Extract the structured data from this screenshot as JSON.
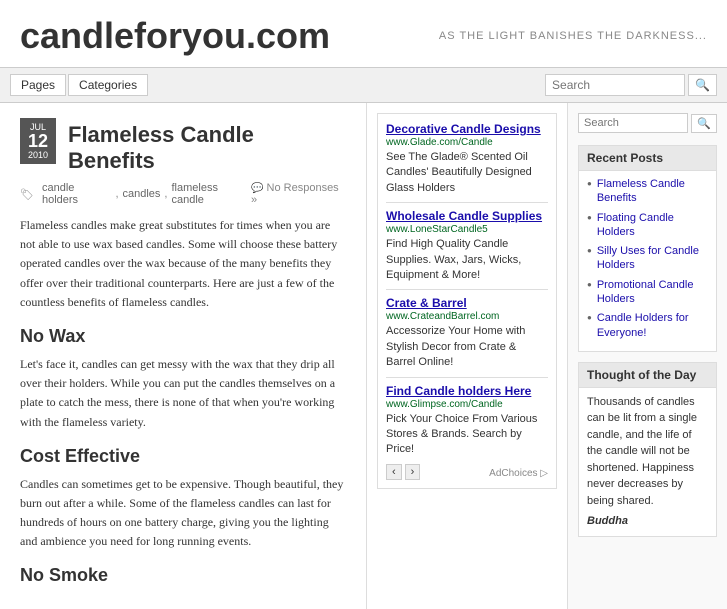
{
  "header": {
    "site_title": "candleforyou.com",
    "tagline": "AS THE LIGHT BANISHES THE DARKNESS...",
    "search_placeholder": "Search"
  },
  "navbar": {
    "tabs": [
      "Pages",
      "Categories"
    ],
    "search_placeholder": "Search"
  },
  "post": {
    "date": {
      "month": "Jul",
      "day": "12",
      "year": "2010"
    },
    "title": "Flameless Candle Benefits",
    "tags": [
      "candle holders",
      "candles",
      "flameless candle"
    ],
    "responses": "No Responses »",
    "intro": "Flameless candles make great substitutes for times when you are not able to use wax based candles. Some will choose these battery operated candles over the wax because of the many benefits they offer over their traditional counterparts. Here are just a few of the countless benefits of flameless candles.",
    "section1_title": "No Wax",
    "section1_body": "Let's face it, candles can get messy with the wax that they drip all over their holders. While you can put the candles themselves on a plate to catch the mess, there is none of that when you're working with the flameless variety.",
    "section2_title": "Cost Effective",
    "section2_body": "Candles can sometimes get to be expensive. Though beautiful, they burn out after a while. Some of the flameless candles can last for hundreds of hours on one battery charge, giving you the lighting and ambience you need for long running events.",
    "section3_title": "No Smoke"
  },
  "ads": [
    {
      "link_text": "Decorative Candle Designs",
      "link_url": "www.Glade.com/Candle",
      "description": "See The Glade® Scented Oil Candles' Beautifully Designed Glass Holders"
    },
    {
      "link_text": "Wholesale Candle Supplies",
      "link_url": "www.LoneStarCandle5",
      "description": "Find High Quality Candle Supplies. Wax, Jars, Wicks, Equipment & More!"
    },
    {
      "link_text": "Crate & Barrel",
      "link_url": "www.CrateandBarrel.com",
      "description": "Accessorize Your Home with Stylish Decor from Crate & Barrel Online!"
    },
    {
      "link_text": "Find Candle holders Here",
      "link_url": "www.Glimpse.com/Candle",
      "description": "Pick Your Choice From Various Stores & Brands. Search by Price!"
    }
  ],
  "ad_choices": "AdChoices ▷",
  "sidebar": {
    "search_placeholder": "Search",
    "recent_posts_title": "Recent Posts",
    "recent_posts": [
      "Flameless Candle Benefits",
      "Floating Candle Holders",
      "Silly Uses for Candle Holders",
      "Promotional Candle Holders",
      "Candle Holders for Everyone!"
    ],
    "thought_title": "Thought of the Day",
    "thought_text": "Thousands of candles can be lit from a single candle, and the life of the candle will not be shortened. Happiness never decreases by being shared.",
    "thought_author": "Buddha"
  }
}
